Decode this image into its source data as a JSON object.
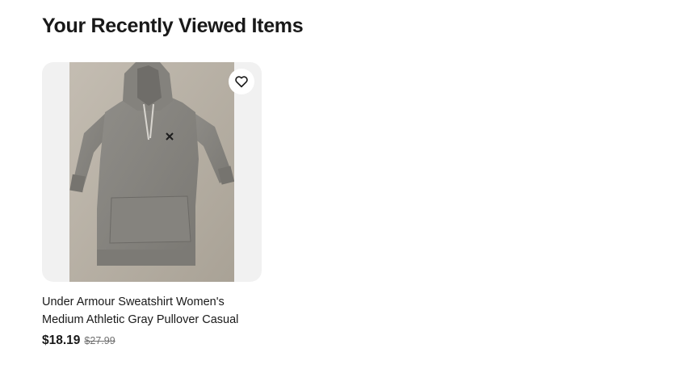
{
  "section": {
    "title": "Your Recently Viewed Items"
  },
  "items": [
    {
      "title": "Under Armour Sweatshirt Women's Medium Athletic Gray Pullover Casual",
      "price": "$18.19",
      "original_price": "$27.99",
      "watch_icon": "heart-icon"
    }
  ]
}
